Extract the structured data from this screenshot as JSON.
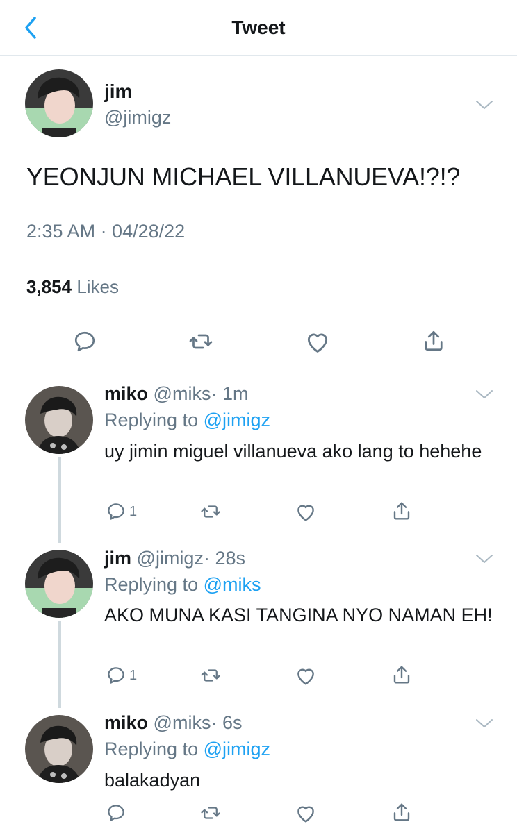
{
  "header": {
    "title": "Tweet"
  },
  "main_tweet": {
    "name": "jim",
    "handle": "@jimigz",
    "text": "YEONJUN MICHAEL VILLANUEVA!?!?",
    "timestamp": "2:35 AM · 04/28/22",
    "likes_count": "3,854",
    "likes_label": "Likes"
  },
  "replies": [
    {
      "name": "miko",
      "handle": "@miks",
      "time": "· 1m",
      "replying_prefix": "Replying to",
      "replying_to": "@jimigz",
      "text": "uy jimin miguel villanueva ako lang to hehehe",
      "reply_count": "1"
    },
    {
      "name": "jim",
      "handle": "@jimigz",
      "time": "· 28s",
      "replying_prefix": "Replying to",
      "replying_to": "@miks",
      "text": "AKO MUNA KASI TANGINA NYO NAMAN EH!",
      "reply_count": "1"
    },
    {
      "name": "miko",
      "handle": "@miks",
      "time": "· 6s",
      "replying_prefix": "Replying to",
      "replying_to": "@jimigz",
      "text": "balakadyan",
      "reply_count": ""
    }
  ],
  "icons": {
    "back": "chevron-left-icon",
    "more": "chevron-down-icon",
    "reply": "comment-icon",
    "retweet": "retweet-icon",
    "like": "heart-icon",
    "share": "share-icon"
  },
  "colors": {
    "accent": "#1da1f2",
    "secondary_text": "#657786",
    "primary_text": "#14171a",
    "divider": "#e1e8ed",
    "thread_line": "#cfd9de"
  }
}
